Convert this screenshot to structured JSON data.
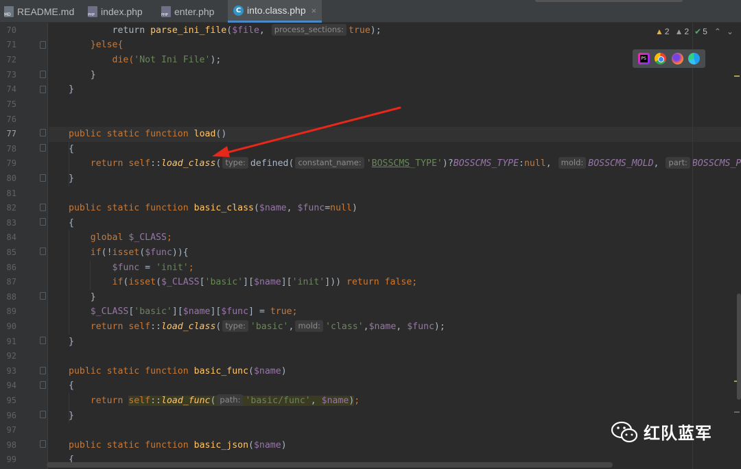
{
  "tabs": [
    {
      "label": "README.md",
      "icon": "markdown-file-icon",
      "active": false
    },
    {
      "label": "index.php",
      "icon": "php-file-icon",
      "active": false
    },
    {
      "label": "enter.php",
      "icon": "php-file-icon",
      "active": false
    },
    {
      "label": "into.class.php",
      "icon": "php-class-icon",
      "active": true
    }
  ],
  "tab_close_glyph": "×",
  "inspections": {
    "warnings": "2",
    "weak_warnings": "2",
    "typos": "5",
    "warning_glyph": "▲",
    "check_glyph": "✔",
    "up_glyph": "⌃",
    "down_glyph": "⌄"
  },
  "browsers": [
    "phpstorm-icon",
    "chrome-icon",
    "firefox-icon",
    "edge-icon"
  ],
  "line_numbers": [
    "70",
    "71",
    "72",
    "73",
    "74",
    "75",
    "76",
    "77",
    "78",
    "79",
    "80",
    "81",
    "82",
    "83",
    "84",
    "85",
    "86",
    "87",
    "88",
    "89",
    "90",
    "91",
    "92",
    "93",
    "94",
    "95",
    "96",
    "97",
    "98",
    "99"
  ],
  "current_line": "77",
  "hints": {
    "process_sections": "process_sections:",
    "type": "type:",
    "constant_name": "constant_name:",
    "mold": "mold:",
    "part": "part:",
    "path": "path:"
  },
  "code": {
    "l70_a": "        return ",
    "l70_fn": "parse_ini_file",
    "l70_b": "(",
    "l70_var": "$file",
    "l70_c": ", ",
    "l70_val": "true",
    "l70_d": ");",
    "l71": "    }else{",
    "l72_a": "        die(",
    "l72_str": "'Not Ini File'",
    "l72_b": ");",
    "l73": "    }",
    "l74": "}",
    "l77_kw": "public static function ",
    "l77_fn": "load",
    "l77_b": "()",
    "l78": "{",
    "l79_kw": "    return self",
    "l79_op": "::",
    "l79_fn": "load_class",
    "l79_b": "(",
    "l79_c": "defined(",
    "l79_str1": "'",
    "l79_str_u": "BOSSCMS",
    "l79_str2": "_TYPE'",
    "l79_d": ")?",
    "l79_cst1": "BOSSCMS_TYPE",
    "l79_e": ":",
    "l79_null": "null",
    "l79_f": ", ",
    "l79_cst2": "BOSSCMS_MOLD",
    "l79_g": ", ",
    "l79_cst3": "BOSSCMS_PAR",
    "l80": "}",
    "l82_kw": "public static function ",
    "l82_fn": "basic_class",
    "l82_b": "(",
    "l82_v1": "$name",
    "l82_c": ", ",
    "l82_v2": "$func",
    "l82_d": "=",
    "l82_null": "null",
    "l82_e": ")",
    "l83": "{",
    "l84_kw": "    global ",
    "l84_var": "$_CLASS",
    "l84_b": ";",
    "l85_kw": "    if",
    "l85_b": "(!",
    "l85_kw2": "isset",
    "l85_c": "(",
    "l85_var": "$func",
    "l85_d": ")){",
    "l86_a": "        ",
    "l86_var": "$func",
    "l86_b": " = ",
    "l86_str": "'init'",
    "l86_c": ";",
    "l87_kw": "        if",
    "l87_b": "(",
    "l87_kw2": "isset",
    "l87_c": "(",
    "l87_v1": "$_CLASS",
    "l87_d": "[",
    "l87_s1": "'basic'",
    "l87_e": "][",
    "l87_v2": "$name",
    "l87_f": "][",
    "l87_s2": "'init'",
    "l87_g": "])) ",
    "l87_kw3": "return false",
    "l87_h": ";",
    "l88": "    }",
    "l89_a": "    ",
    "l89_v1": "$_CLASS",
    "l89_b": "[",
    "l89_s1": "'basic'",
    "l89_c": "][",
    "l89_v2": "$name",
    "l89_d": "][",
    "l89_v3": "$func",
    "l89_e": "] = ",
    "l89_kw": "true",
    "l89_f": ";",
    "l90_kw": "    return self",
    "l90_op": "::",
    "l90_fn": "load_class",
    "l90_b": "(",
    "l90_s1": "'basic'",
    "l90_c": ",",
    "l90_s2": "'class'",
    "l90_d": ",",
    "l90_v1": "$name",
    "l90_e": ", ",
    "l90_v2": "$func",
    "l90_f": ");",
    "l91": "}",
    "l93_kw": "public static function ",
    "l93_fn": "basic_func",
    "l93_b": "(",
    "l93_var": "$name",
    "l93_c": ")",
    "l94": "{",
    "l95_a": "    ",
    "l95_kw": "return ",
    "l95_self": "self",
    "l95_op": "::",
    "l95_fn": "load_func",
    "l95_b": "(",
    "l95_s": "'basic/func'",
    "l95_c": ", ",
    "l95_var": "$name",
    "l95_d": ")",
    "l95_e": ";",
    "l96": "}",
    "l98_kw": "public static function ",
    "l98_fn": "basic_json",
    "l98_b": "(",
    "l98_var": "$name",
    "l98_c": ")",
    "l99": "{"
  },
  "watermark": {
    "text": "红队蓝军",
    "logo": "wechat-logo-icon"
  },
  "colors": {
    "annotation_arrow": "#e8271b",
    "accent": "#4a88c7"
  }
}
